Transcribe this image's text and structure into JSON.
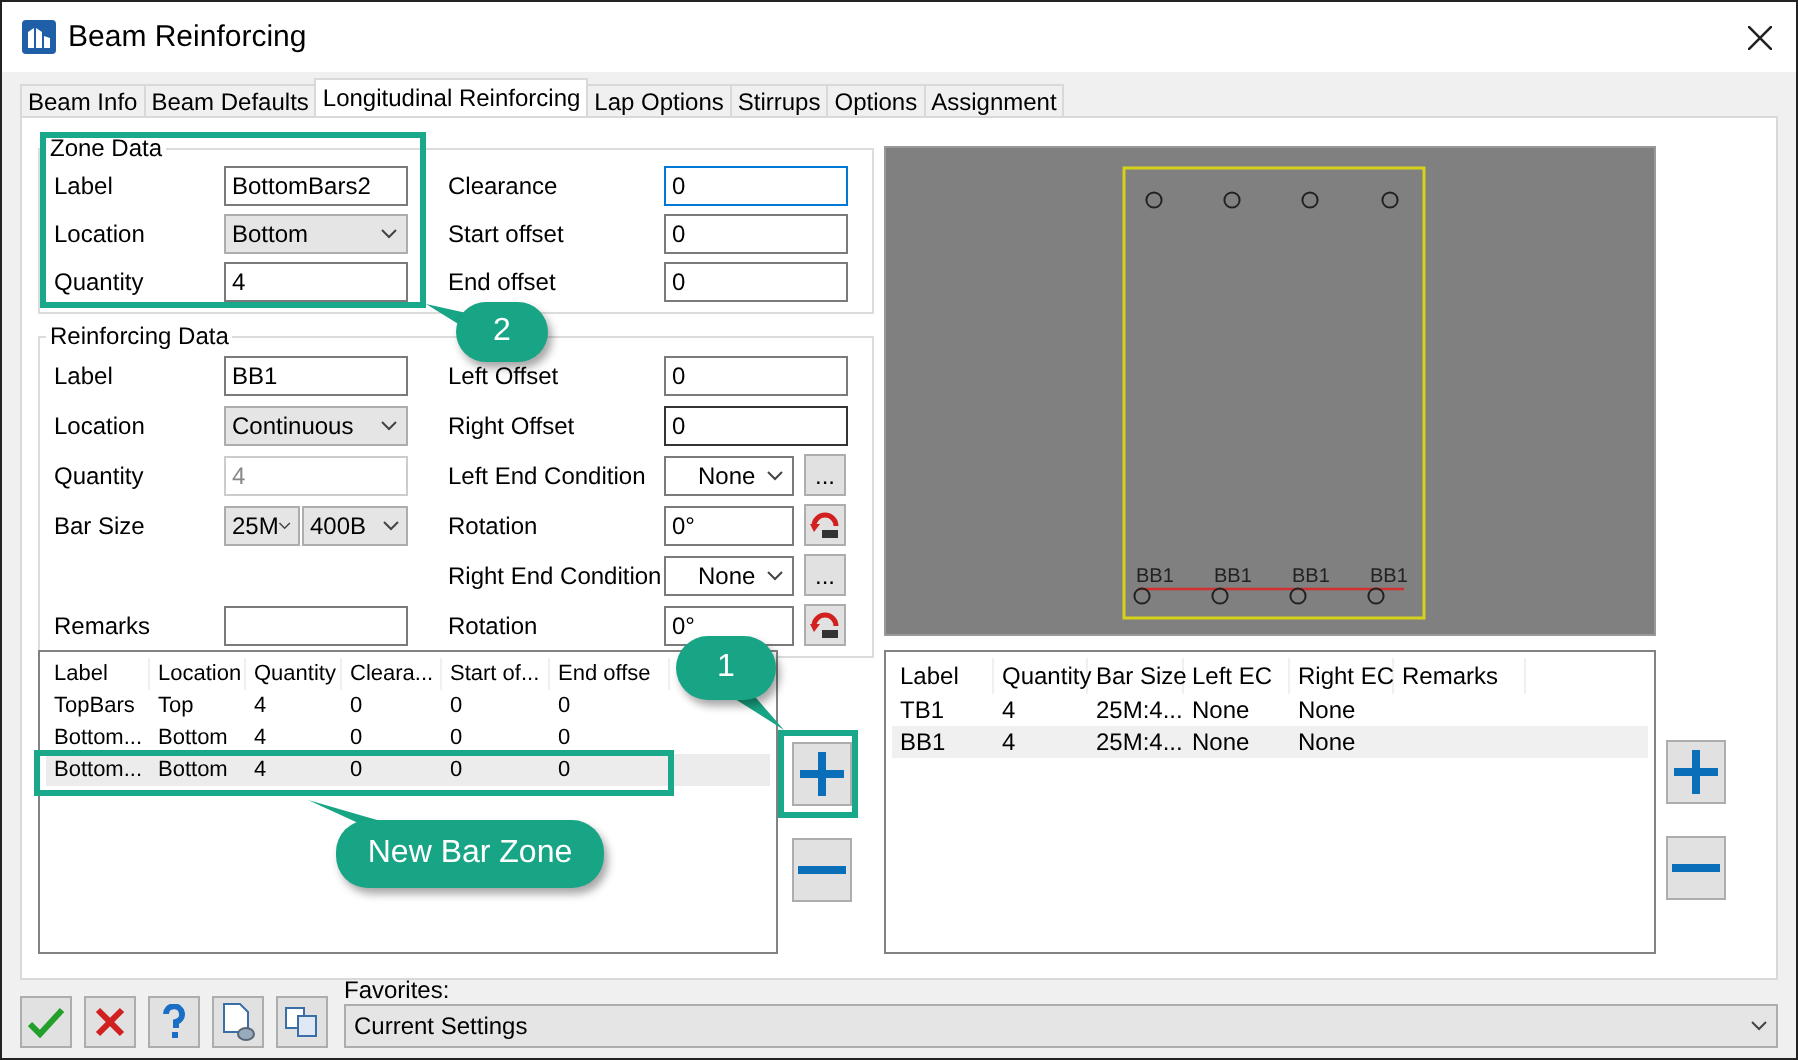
{
  "window": {
    "title": "Beam Reinforcing"
  },
  "tabs": [
    {
      "label": "Beam Info",
      "selected": false
    },
    {
      "label": "Beam Defaults",
      "selected": false
    },
    {
      "label": "Longitudinal Reinforcing",
      "selected": true
    },
    {
      "label": "Lap Options",
      "selected": false
    },
    {
      "label": "Stirrups",
      "selected": false
    },
    {
      "label": "Options",
      "selected": false
    },
    {
      "label": "Assignment",
      "selected": false
    }
  ],
  "zone_data": {
    "title": "Zone Data",
    "rows": [
      {
        "left": {
          "label": "Label",
          "kind": "text",
          "value": "BottomBars2",
          "focused": false,
          "disabled": false
        },
        "right": {
          "label": "Clearance",
          "kind": "text",
          "value": "0",
          "focused": true,
          "disabled": false
        }
      },
      {
        "left": {
          "label": "Location",
          "kind": "select",
          "value": "Bottom"
        },
        "right": {
          "label": "Start offset",
          "kind": "text",
          "value": "0",
          "focused": false,
          "disabled": false
        }
      },
      {
        "left": {
          "label": "Quantity",
          "kind": "text",
          "value": "4",
          "focused": false,
          "disabled": false
        },
        "right": {
          "label": "End offset",
          "kind": "text",
          "value": "0",
          "focused": false,
          "disabled": false
        }
      }
    ]
  },
  "reinforcing_data": {
    "title": "Reinforcing Data",
    "rows": [
      {
        "left": {
          "label": "Label",
          "kind": "text",
          "value": "BB1",
          "focused": false,
          "disabled": false
        },
        "right": {
          "label": "Left Offset",
          "kind": "text",
          "value": "0",
          "focused": false,
          "disabled": false
        }
      },
      {
        "left": {
          "label": "Location",
          "kind": "select",
          "value": "Continuous"
        },
        "right": {
          "label": "Right Offset",
          "kind": "text",
          "value": "0",
          "focused": true,
          "disabled": false
        }
      },
      {
        "left": {
          "label": "Quantity",
          "kind": "text",
          "value": "4",
          "focused": false,
          "disabled": true
        },
        "right": {
          "label": "Left End Condition",
          "kind": "select-more",
          "value": "None",
          "button": "..."
        }
      },
      {
        "left": {
          "label": "Bar Size",
          "kind": "select-pair",
          "values": [
            "25M",
            "400B"
          ]
        },
        "right": {
          "label": "Rotation",
          "kind": "angle",
          "value": "0°"
        }
      },
      {
        "right": {
          "label": "Right End Condition",
          "kind": "select-more",
          "value": "None",
          "button": "..."
        }
      },
      {
        "left": {
          "label": "Remarks",
          "kind": "text",
          "focused": false,
          "disabled": false
        },
        "right": {
          "label": "Rotation",
          "kind": "angle",
          "value": "0°"
        }
      }
    ]
  },
  "section": {
    "bar_labels": [
      "BB1",
      "BB1",
      "BB1",
      "BB1"
    ]
  },
  "zones_table": {
    "columns": [
      "Label",
      "Location",
      "Quantity",
      "Cleara...",
      "Start of...",
      "End offse"
    ],
    "rows": [
      {
        "cells": [
          "TopBars",
          "Top",
          "4",
          "0",
          "0",
          "0"
        ],
        "selected": false
      },
      {
        "cells": [
          "Bottom...",
          "Bottom",
          "4",
          "0",
          "0",
          "0"
        ],
        "selected": false
      },
      {
        "cells": [
          "Bottom...",
          "Bottom",
          "4",
          "0",
          "0",
          "0"
        ],
        "selected": true
      }
    ]
  },
  "bars_table": {
    "columns": [
      "Label",
      "Quantity",
      "Bar Size",
      "Left EC",
      "Right EC",
      "Remarks"
    ],
    "rows": [
      {
        "cells": [
          "TB1",
          "4",
          "25M:4...",
          "None",
          "None"
        ],
        "selected": false
      },
      {
        "cells": [
          "BB1",
          "4",
          "25M:4...",
          "None",
          "None"
        ],
        "selected": true
      }
    ]
  },
  "footer": {
    "favorites_label": "Favorites:",
    "favorites_value": "Current Settings"
  },
  "callouts": [
    {
      "text": "2"
    },
    {
      "text": "1"
    },
    {
      "text": "New Bar Zone"
    }
  ]
}
